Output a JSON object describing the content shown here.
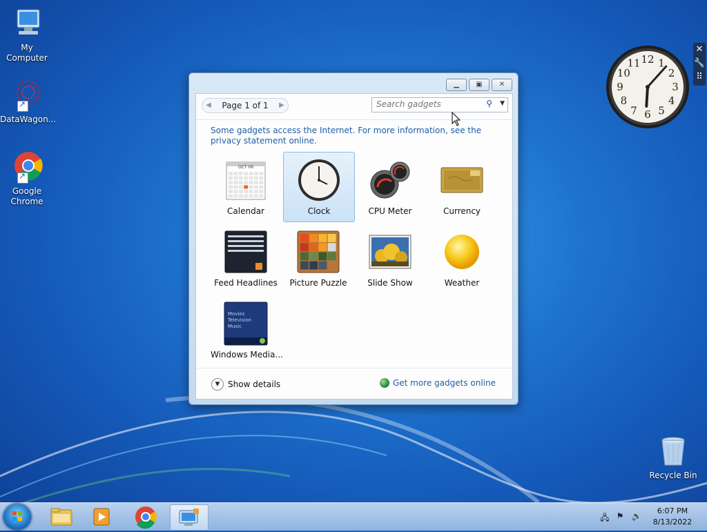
{
  "desktop": {
    "icons": [
      {
        "label": "My Computer"
      },
      {
        "label": "DataWagon..."
      },
      {
        "label": "Google Chrome"
      },
      {
        "label": "Recycle Bin"
      }
    ]
  },
  "clock_gadget": {
    "numbers": [
      "12",
      "1",
      "2",
      "3",
      "4",
      "5",
      "6",
      "7",
      "8",
      "9",
      "10",
      "11"
    ],
    "time": "6:07"
  },
  "gadget_window": {
    "pager": {
      "label": "Page 1 of 1"
    },
    "search": {
      "placeholder": "Search gadgets"
    },
    "notice": "Some gadgets access the Internet.  For more information, see the privacy statement online.",
    "gadgets": [
      {
        "name": "Calendar",
        "selected": false
      },
      {
        "name": "Clock",
        "selected": true
      },
      {
        "name": "CPU Meter",
        "selected": false
      },
      {
        "name": "Currency",
        "selected": false
      },
      {
        "name": "Feed Headlines",
        "selected": false
      },
      {
        "name": "Picture Puzzle",
        "selected": false
      },
      {
        "name": "Slide Show",
        "selected": false
      },
      {
        "name": "Weather",
        "selected": false
      },
      {
        "name": "Windows Media...",
        "selected": false
      }
    ],
    "calendar_month": "OCT 06",
    "media_menu": [
      "Movies",
      "Television",
      "Music"
    ],
    "show_details": "Show details",
    "get_more": "Get more gadgets online"
  },
  "taskbar": {
    "time": "6:07 PM",
    "date": "8/13/2022"
  },
  "colors": {
    "link": "#1e5ea6",
    "desktop_bg": "#1f74d0"
  }
}
